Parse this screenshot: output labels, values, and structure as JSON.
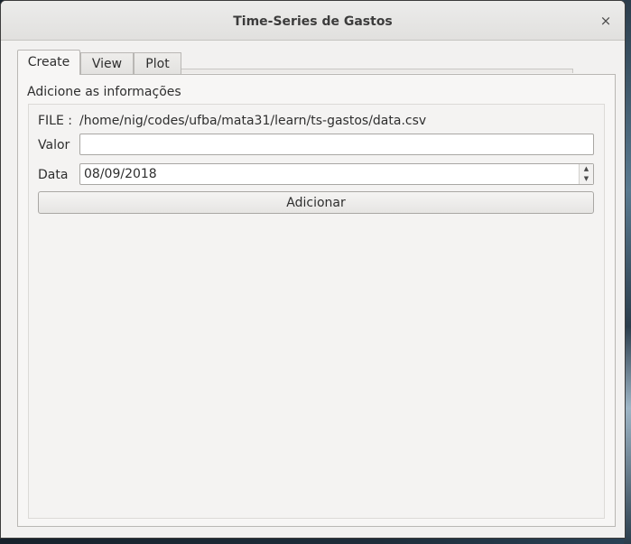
{
  "window": {
    "title": "Time-Series de Gastos",
    "close_glyph": "×"
  },
  "tabs": [
    {
      "label": "Create",
      "active": true
    },
    {
      "label": "View",
      "active": false
    },
    {
      "label": "Plot",
      "active": false
    }
  ],
  "create": {
    "group_title": "Adicione as informações",
    "file_label": "FILE :",
    "file_path": "/home/nig/codes/ufba/mata31/learn/ts-gastos/data.csv",
    "valor_label": "Valor",
    "valor_value": "",
    "data_label": "Data",
    "data_value": "08/09/2018",
    "spin_up": "▲",
    "spin_down": "▼",
    "add_button": "Adicionar"
  },
  "icons": {
    "close": "close-icon",
    "spin_up": "chevron-up-icon",
    "spin_down": "chevron-down-icon"
  }
}
